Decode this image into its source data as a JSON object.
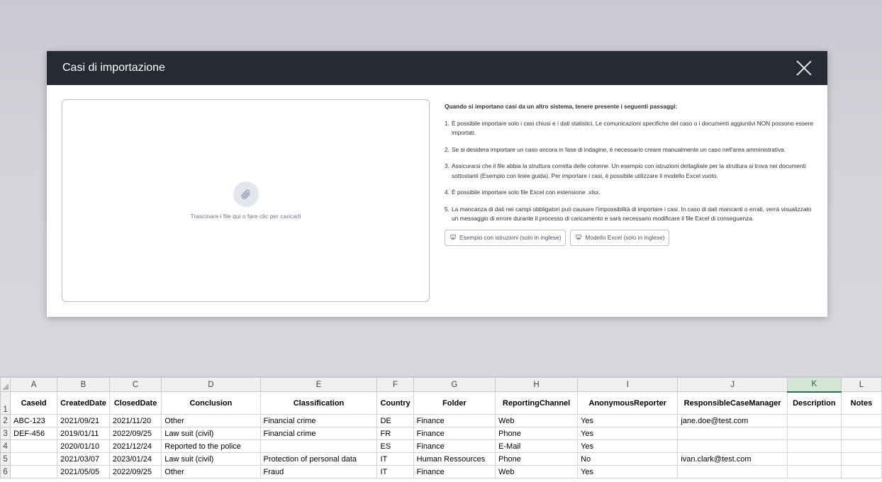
{
  "modal": {
    "title": "Casi di importazione",
    "close_icon": "close-icon",
    "dropzone": {
      "icon": "paperclip-icon",
      "text": "Trascinare i file qui o fare clic per caricarli"
    },
    "instructions": {
      "heading": "Quando si importano casi da un altro sistema, tenere presente i seguenti passaggi:",
      "items": [
        {
          "num": "1.",
          "text": "È possibile importare solo i casi chiusi e i dati statistici. Le comunicazioni specifiche del caso o i documenti aggiuntivi NON possono essere importati."
        },
        {
          "num": "2.",
          "text": "Se si desidera importare un caso ancora in fase di indagine, è necessario creare manualmente un caso nell'area amministrativa."
        },
        {
          "num": "3.",
          "text": "Assicurarsi che il file abbia la struttura corretta delle colonne. Un esempio con istruzioni dettagliate per la struttura si trova nei documenti sottostanti (Esempio con linee guida). Per importare i casi, è possibile utilizzare il modello Excel vuoto."
        },
        {
          "num": "4.",
          "text": "È possibile importare solo file Excel con estensione .xlsx."
        },
        {
          "num": "5.",
          "text": "La mancanza di dati nei campi obbligatori può causare l'impossibilità di importare i casi. In caso di dati mancanti o errati, verrà visualizzato un messaggio di errore durante il processo di caricamento e sarà necessario modificare il file Excel di conseguenza."
        }
      ]
    },
    "downloads": [
      {
        "icon": "download-icon",
        "label": "Esempio con istruzioni (solo in inglese)"
      },
      {
        "icon": "download-icon",
        "label": "Modello Excel (solo in inglese)"
      }
    ]
  },
  "spreadsheet": {
    "column_letters": [
      "A",
      "B",
      "C",
      "D",
      "E",
      "F",
      "G",
      "H",
      "I",
      "J",
      "K",
      "L"
    ],
    "selected_column": "K",
    "headers": [
      "CaseId",
      "CreatedDate",
      "ClosedDate",
      "Conclusion",
      "Classification",
      "Country",
      "Folder",
      "ReportingChannel",
      "AnonymousReporter",
      "ResponsibleCaseManager",
      "Description",
      "Notes"
    ],
    "row_numbers": [
      "1",
      "2",
      "3",
      "4",
      "5",
      "6"
    ],
    "rows": [
      [
        "ABC-123",
        "2021/09/21",
        "2021/11/20",
        "Other",
        "Financial crime",
        "DE",
        "Finance",
        "Web",
        "Yes",
        "jane.doe@test.com",
        "",
        ""
      ],
      [
        "DEF-456",
        "2019/01/11",
        "2022/09/25",
        "Law suit (civil)",
        "Financial crime",
        "FR",
        "Finance",
        "Phone",
        "Yes",
        "",
        "",
        ""
      ],
      [
        "",
        "2020/01/10",
        "2021/12/24",
        "Reported to the police",
        "",
        "ES",
        "Finance",
        "E-Mail",
        "Yes",
        "",
        "",
        ""
      ],
      [
        "",
        "2021/03/07",
        "2023/01/24",
        "Law suit (civil)",
        "Protection of personal data",
        "IT",
        "Human Ressources",
        "Phone",
        "No",
        "ivan.clark@test.com",
        "",
        ""
      ],
      [
        "",
        "2021/05/05",
        "2022/09/25",
        "Other",
        "Fraud",
        "IT",
        "Finance",
        "Web",
        "Yes",
        "",
        "",
        ""
      ]
    ]
  }
}
